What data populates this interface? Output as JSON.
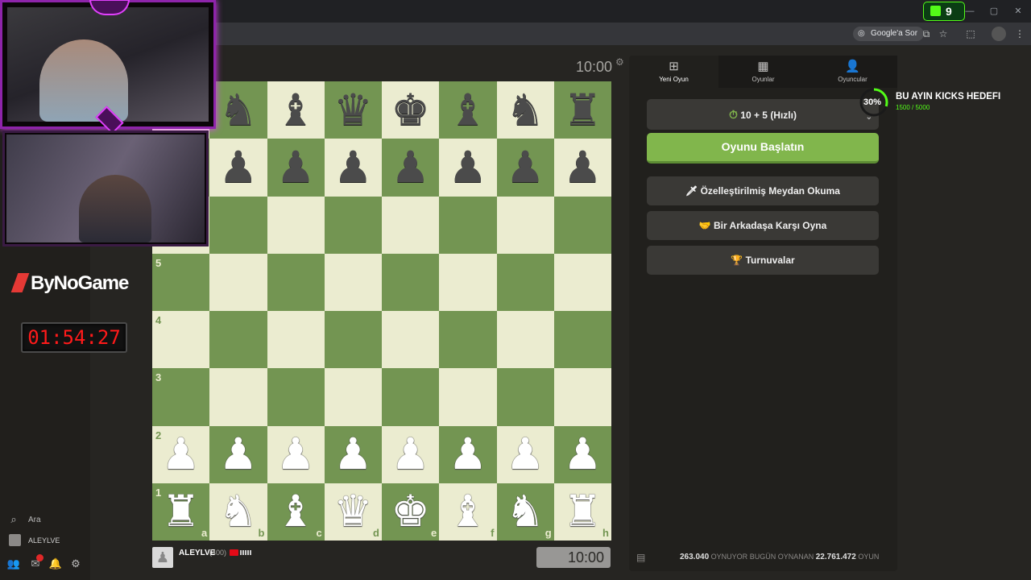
{
  "browser": {
    "google_chip": "Google'a Sor",
    "kick_count": "9"
  },
  "overlay": {
    "brand": "ByNoGame",
    "timer": "01:54:27",
    "goal_percent": "30%",
    "goal_title": "BU AYIN KICKS HEDEFI",
    "goal_progress": "1500 / 5000",
    "goal_fraction": 0.3
  },
  "sidebar": {
    "search_label": "Ara",
    "username": "ALEYLVE"
  },
  "game": {
    "top_clock": "10:00",
    "bottom_clock": "10:00",
    "player_name": "ALEYLVE",
    "player_rating": "(400)",
    "board": [
      [
        "♜",
        "♞",
        "♝",
        "♛",
        "♚",
        "♝",
        "♞",
        "♜"
      ],
      [
        "♟",
        "♟",
        "♟",
        "♟",
        "♟",
        "♟",
        "♟",
        "♟"
      ],
      [
        "",
        "",
        "",
        "",
        "",
        "",
        "",
        ""
      ],
      [
        "",
        "",
        "",
        "",
        "",
        "",
        "",
        ""
      ],
      [
        "",
        "",
        "",
        "",
        "",
        "",
        "",
        ""
      ],
      [
        "",
        "",
        "",
        "",
        "",
        "",
        "",
        ""
      ],
      [
        "♟",
        "♟",
        "♟",
        "♟",
        "♟",
        "♟",
        "♟",
        "♟"
      ],
      [
        "♜",
        "♞",
        "♝",
        "♛",
        "♚",
        "♝",
        "♞",
        "♜"
      ]
    ],
    "rank_labels": [
      "",
      "",
      "",
      "5",
      "4",
      "3",
      "2",
      "1"
    ],
    "file_labels": [
      "a",
      "b",
      "c",
      "d",
      "e",
      "f",
      "g",
      "h"
    ]
  },
  "panel": {
    "tabs": [
      {
        "label": "Yeni Oyun",
        "icon": "plus-square-icon"
      },
      {
        "label": "Oyunlar",
        "icon": "board-icon"
      },
      {
        "label": "Oyuncular",
        "icon": "players-icon"
      }
    ],
    "time_control": "10 + 5 (Hızlı)",
    "start_button": "Oyunu Başlatın",
    "custom_challenge": "Özelleştirilmiş Meydan Okuma",
    "play_friend": "Bir Arkadaşa Karşı Oyna",
    "tournaments": "Turnuvalar",
    "stats": {
      "playing_count": "263.040",
      "playing_label": "OYNUYOR",
      "today_label": "BUGÜN OYNANAN",
      "today_count": "22.761.472",
      "games_label": "OYUN"
    }
  },
  "colors": {
    "board_light": "#ebecd0",
    "board_dark": "#739552",
    "accent_green": "#81b64c",
    "overlay_purple": "#e040fb",
    "timer_red": "#ff1a1a"
  }
}
